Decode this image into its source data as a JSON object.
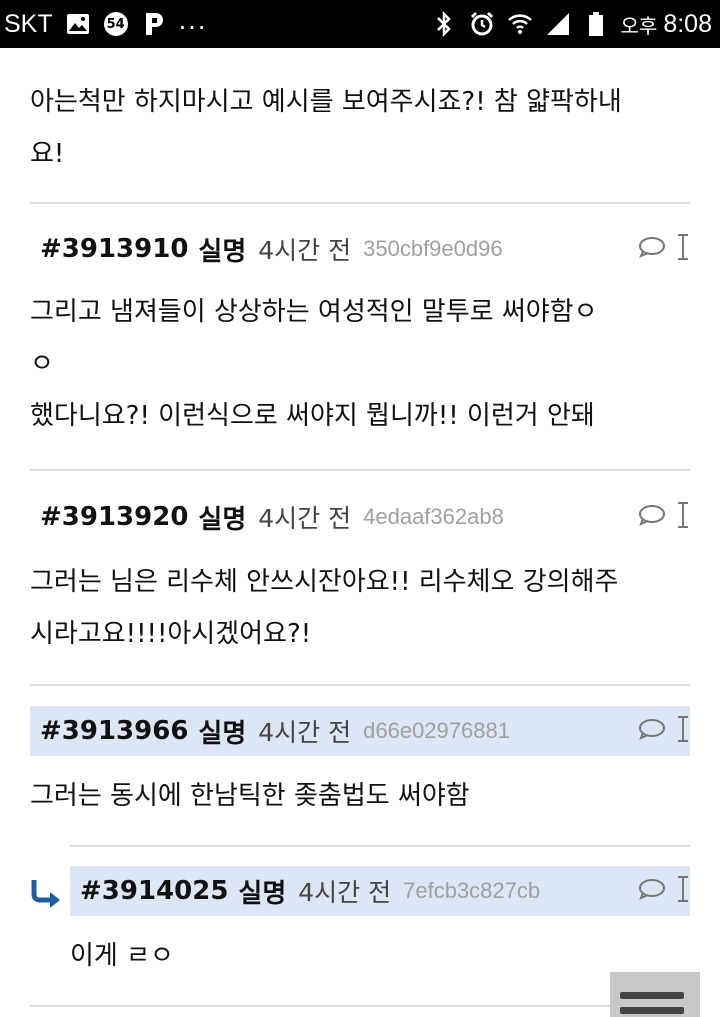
{
  "status_bar": {
    "carrier": "SKT",
    "notification_count": "54",
    "ellipsis": "...",
    "ampm": "오후",
    "time": "8:08"
  },
  "thread": {
    "top_fragment": {
      "lines": [
        "아는척만 하지마시고 예시를 보여주시죠?! 참 얇팍하내",
        "요!"
      ]
    },
    "comments": [
      {
        "id": "#3913910",
        "author": "실명",
        "time": "4시간 전",
        "hash": "350cbf9e0d96",
        "lines": [
          "그리고 냄져들이 상상하는 여성적인 말투로 써야함ㅇ",
          "ㅇ",
          "했다니요?! 이런식으로 써야지 뭡니까!! 이런거 안돼"
        ],
        "highlighted": false
      },
      {
        "id": "#3913920",
        "author": "실명",
        "time": "4시간 전",
        "hash": "4edaaf362ab8",
        "lines": [
          "그러는 님은 리수체 안쓰시잔아요!! 리수체오 강의해주",
          "시라고요!!!!아시겠어요?!"
        ],
        "highlighted": false
      },
      {
        "id": "#3913966",
        "author": "실명",
        "time": "4시간 전",
        "hash": "d66e02976881",
        "lines": [
          "그러는 동시에 한남틱한 좆춤법도 써야함"
        ],
        "highlighted": true
      }
    ],
    "reply": {
      "id": "#3914025",
      "author": "실명",
      "time": "4시간 전",
      "hash": "7efcb3c827cb",
      "lines": [
        "이게 ㄹㅇ"
      ],
      "highlighted": true
    }
  },
  "colors": {
    "highlight": "#dce6f5",
    "reply_arrow": "#1a5ea8",
    "divider": "#dcdcdc",
    "hash_text": "#a0a0a0"
  },
  "icons": [
    "image-icon",
    "notification-badge-icon",
    "app-p-icon",
    "bluetooth-icon",
    "alarm-icon",
    "wifi-icon",
    "signal-icon",
    "battery-icon",
    "comment-bubble-icon",
    "text-cursor-icon",
    "reply-arrow-icon",
    "menu-lines-icon"
  ]
}
